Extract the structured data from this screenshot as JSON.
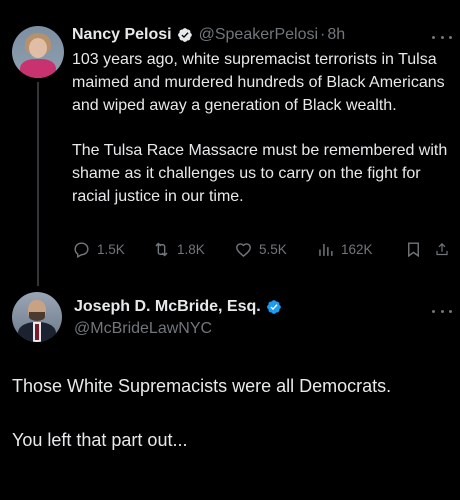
{
  "original_tweet": {
    "author_name": "Nancy Pelosi",
    "handle": "@SpeakerPelosi",
    "separator": "·",
    "time": "8h",
    "paragraph1": "103 years ago, white supremacist terrorists in Tulsa maimed and murdered hundreds of Black Americans and wiped away a generation of Black wealth.",
    "paragraph2": "The Tulsa Race Massacre must be remembered with shame as it challenges us to carry on the fight for racial justice in our time.",
    "replies": "1.5K",
    "retweets": "1.8K",
    "likes": "5.5K",
    "views": "162K"
  },
  "reply_tweet": {
    "author_name": "Joseph D. McBride, Esq.",
    "handle": "@McBrideLawNYC",
    "paragraph1": "Those White Supremacists were all Democrats.",
    "paragraph2": "You left that part out..."
  },
  "colors": {
    "background": "#000000",
    "text": "#e7e9ea",
    "muted": "#71767b",
    "verified": "#1d9bf0"
  }
}
